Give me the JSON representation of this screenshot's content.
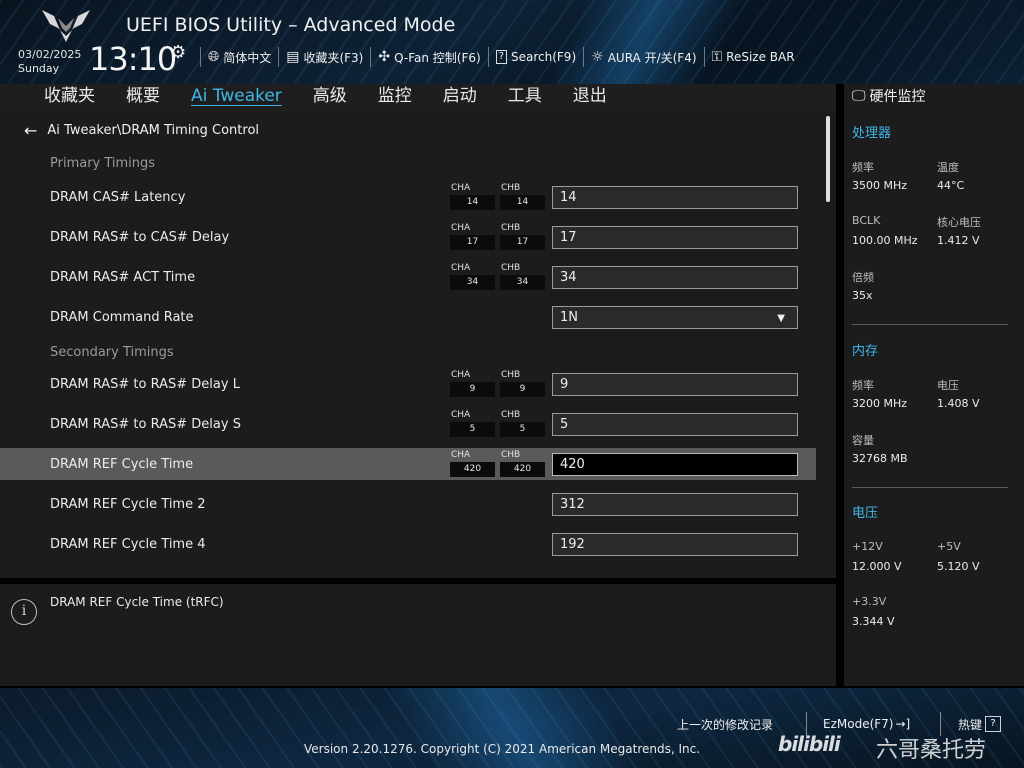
{
  "header": {
    "title": "UEFI BIOS Utility – Advanced Mode",
    "date": "03/02/2025",
    "day": "Sunday",
    "time": "13:10",
    "toolbar": [
      {
        "label": "简体中文",
        "icon": "globe-icon"
      },
      {
        "label": "收藏夹(F3)",
        "icon": "favorites-icon"
      },
      {
        "label": "Q-Fan 控制(F6)",
        "icon": "fan-icon"
      },
      {
        "label": "Search(F9)",
        "icon": "search-help-icon"
      },
      {
        "label": "AURA 开/关(F4)",
        "icon": "aura-light-icon"
      },
      {
        "label": "ReSize BAR",
        "icon": "resize-bar-icon"
      }
    ]
  },
  "menu": [
    "收藏夹",
    "概要",
    "Ai Tweaker",
    "高级",
    "监控",
    "启动",
    "工具",
    "退出"
  ],
  "menu_active": "Ai Tweaker",
  "breadcrumb": "Ai Tweaker\\DRAM Timing Control",
  "rows": [
    {
      "label": "Primary Timings",
      "section": true
    },
    {
      "label": "DRAM CAS# Latency",
      "cha": "14",
      "chb": "14",
      "value": "14"
    },
    {
      "label": "DRAM RAS# to CAS# Delay",
      "cha": "17",
      "chb": "17",
      "value": "17"
    },
    {
      "label": "DRAM RAS# ACT Time",
      "cha": "34",
      "chb": "34",
      "value": "34"
    },
    {
      "label": "DRAM Command Rate",
      "value": "1N",
      "dropdown": true
    },
    {
      "label": "Secondary Timings",
      "section": true
    },
    {
      "label": "DRAM RAS# to RAS# Delay L",
      "cha": "9",
      "chb": "9",
      "value": "9"
    },
    {
      "label": "DRAM RAS# to RAS# Delay S",
      "cha": "5",
      "chb": "5",
      "value": "5"
    },
    {
      "label": "DRAM REF Cycle Time",
      "cha": "420",
      "chb": "420",
      "value": "420",
      "selected": true
    },
    {
      "label": "DRAM REF Cycle Time 2",
      "value": "312"
    },
    {
      "label": "DRAM REF Cycle Time 4",
      "value": "192"
    }
  ],
  "channel_labels": {
    "a": "CHA",
    "b": "CHB"
  },
  "info_text": "DRAM REF Cycle Time (tRFC)",
  "hw": {
    "title": "硬件监控",
    "cpu": {
      "title": "处理器",
      "freq_label": "频率",
      "freq": "3500 MHz",
      "temp_label": "温度",
      "temp": "44°C",
      "bclk_label": "BCLK",
      "bclk": "100.00 MHz",
      "vcore_label": "核心电压",
      "vcore": "1.412 V",
      "ratio_label": "倍频",
      "ratio": "35x"
    },
    "mem": {
      "title": "内存",
      "freq_label": "频率",
      "freq": "3200 MHz",
      "volt_label": "电压",
      "volt": "1.408 V",
      "cap_label": "容量",
      "cap": "32768 MB"
    },
    "volt": {
      "title": "电压",
      "v12_label": "+12V",
      "v12": "12.000 V",
      "v5_label": "+5V",
      "v5": "5.120 V",
      "v33_label": "+3.3V",
      "v33": "3.344 V"
    }
  },
  "footer": {
    "last_changes": "上一次的修改记录",
    "ezmode": "EzMode(F7)",
    "hotkeys": "热键",
    "hotkey_cap": "?",
    "version": "Version 2.20.1276. Copyright (C) 2021 American Megatrends, Inc."
  },
  "watermark": {
    "logo": "bilibili",
    "text": "六哥桑托劳"
  }
}
